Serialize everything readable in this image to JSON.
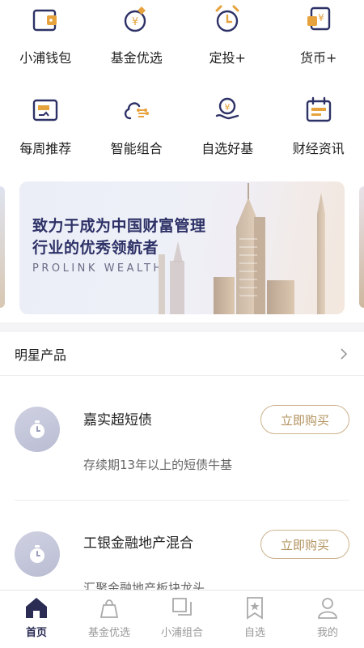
{
  "colors": {
    "navy": "#2d3166",
    "gold": "#e6a23c",
    "buy_border": "#cdb38e",
    "buy_text": "#b2925e",
    "inactive": "#999999"
  },
  "quick_menu": {
    "row1": [
      {
        "label": "小浦钱包",
        "icon": "wallet-icon"
      },
      {
        "label": "基金优选",
        "icon": "fund-select-icon"
      },
      {
        "label": "定投+",
        "icon": "alarm-clock-icon"
      },
      {
        "label": "货币+",
        "icon": "currency-icon"
      }
    ],
    "row2": [
      {
        "label": "每周推荐",
        "icon": "weekly-recommend-icon"
      },
      {
        "label": "智能组合",
        "icon": "cloud-network-icon"
      },
      {
        "label": "自选好基",
        "icon": "hand-coin-icon"
      },
      {
        "label": "财经资讯",
        "icon": "calendar-news-icon"
      }
    ]
  },
  "banner": {
    "line1": "致力于成为中国财富管理",
    "line2": "行业的优秀领航者",
    "tagline": "PROLINK  WEALTH"
  },
  "star_products": {
    "title": "明星产品",
    "items": [
      {
        "name": "嘉实超短债",
        "desc": "存续期13年以上的短债牛基",
        "button": "立即购买"
      },
      {
        "name": "工银金融地产混合",
        "desc": "汇聚金融地产板块龙头",
        "button": "立即购买"
      }
    ]
  },
  "tabbar": [
    {
      "label": "首页",
      "icon": "home-icon",
      "active": true
    },
    {
      "label": "基金优选",
      "icon": "bag-icon",
      "active": false
    },
    {
      "label": "小浦组合",
      "icon": "stack-icon",
      "active": false
    },
    {
      "label": "自选",
      "icon": "bookmark-star-icon",
      "active": false
    },
    {
      "label": "我的",
      "icon": "user-icon",
      "active": false
    }
  ]
}
